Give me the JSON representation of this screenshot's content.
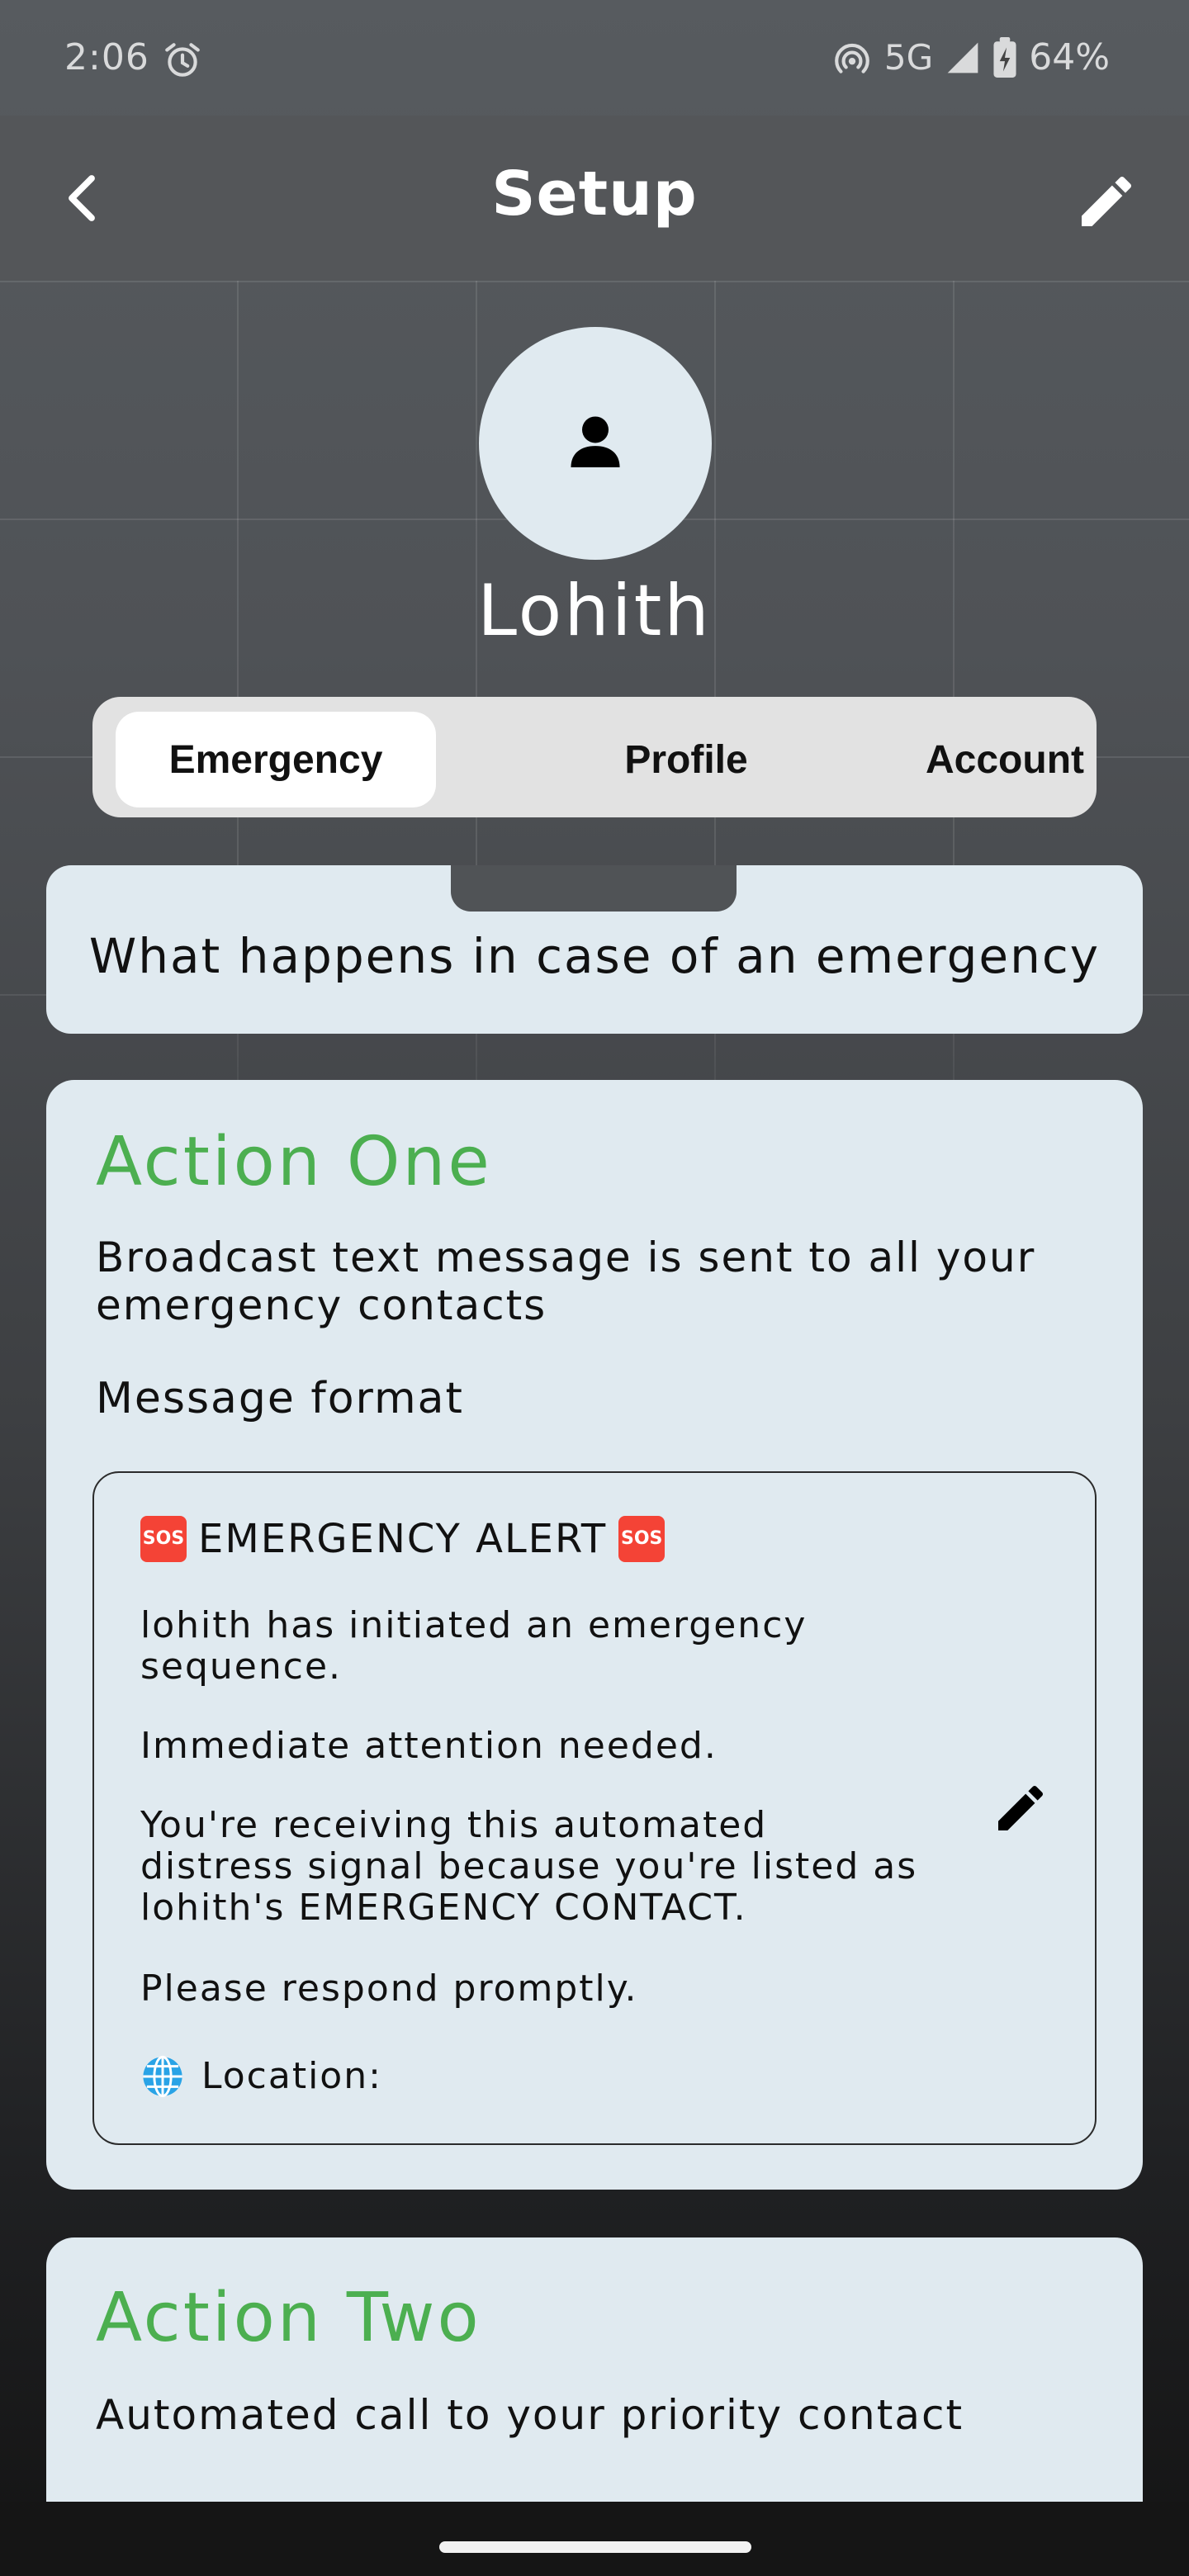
{
  "status_bar": {
    "time": "2:06",
    "network": "5G",
    "battery": "64%"
  },
  "app_bar": {
    "title": "Setup",
    "back_icon": "back-arrow-icon",
    "edit_icon": "pencil-icon"
  },
  "profile": {
    "name": "Lohith",
    "avatar_icon": "person-icon"
  },
  "tabs": [
    {
      "label": "Emergency",
      "active": true
    },
    {
      "label": "Profile",
      "active": false
    },
    {
      "label": "Account",
      "active": false
    }
  ],
  "info": {
    "text": "What happens in case of an emergency"
  },
  "action_one": {
    "title": "Action One",
    "description": "Broadcast text message is sent to all your emergency contacts",
    "format_label": "Message format",
    "message": {
      "alert_prefix_icon": "🆘",
      "alert": "EMERGENCY ALERT",
      "alert_suffix_icon": "🆘",
      "initiated": "lohith has initiated an emergency sequence.",
      "attention": "Immediate attention needed.",
      "receiving": "You're receiving this automated distress signal because you're listed as lohith's EMERGENCY CONTACT.",
      "respond": "Please respond promptly.",
      "location_icon": "🌐",
      "location_label": "Location:"
    }
  },
  "action_two": {
    "title": "Action Two",
    "description": "Automated call to your priority contact"
  },
  "colors": {
    "accent_green": "#4caf50",
    "card_bg": "#e0eaf0",
    "header_bg": "#545659"
  }
}
